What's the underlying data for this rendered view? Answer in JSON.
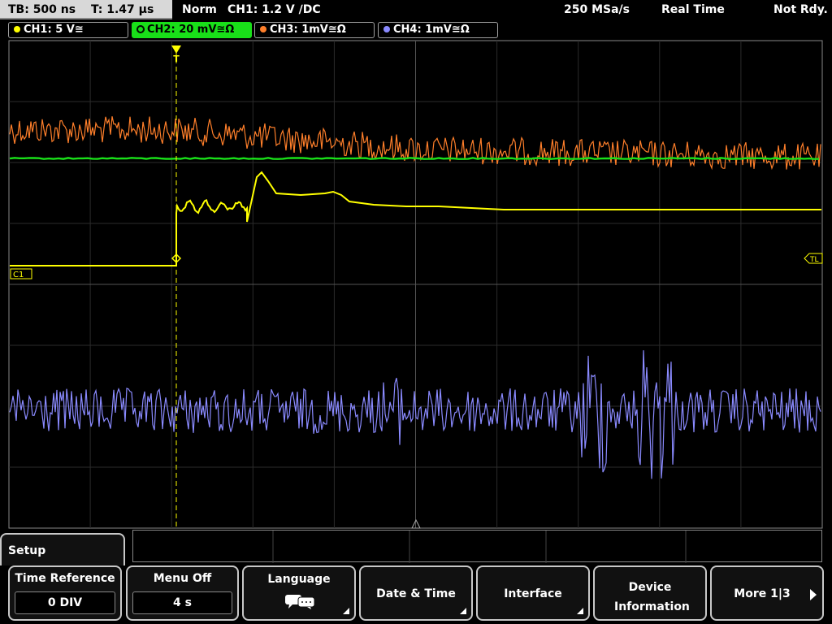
{
  "top": {
    "timebase": "TB: 500 ns",
    "trigger_time": "T: 1.47 µs",
    "mode": "Norm",
    "trigger_info": "CH1: 1.2 V ∕DC",
    "sample_rate": "250 MSa/s",
    "acq_mode": "Real Time",
    "status": "Not Rdy."
  },
  "channels": [
    {
      "label": "CH1: 5 V≅",
      "color": "#ffff00"
    },
    {
      "label": "CH2: 20 mV≅Ω",
      "color": "#19e019"
    },
    {
      "label": "CH3: 1mV≅Ω",
      "color": "#ff7f2a"
    },
    {
      "label": "CH4: 1mV≅Ω",
      "color": "#8a8aff"
    }
  ],
  "markers": {
    "ch1": "C1",
    "trigger_level": "TL",
    "trigger_pos": "T"
  },
  "menu": {
    "title": "Setup",
    "softkeys": [
      {
        "label": "Time Reference",
        "value": "0 DIV"
      },
      {
        "label": "Menu Off",
        "value": "4 s"
      },
      {
        "label": "Language",
        "icon": "speech-bubbles-icon"
      },
      {
        "label": "Date & Time"
      },
      {
        "label": "Interface"
      },
      {
        "label": "Device Information"
      },
      {
        "label": "More 1|3"
      }
    ]
  }
}
